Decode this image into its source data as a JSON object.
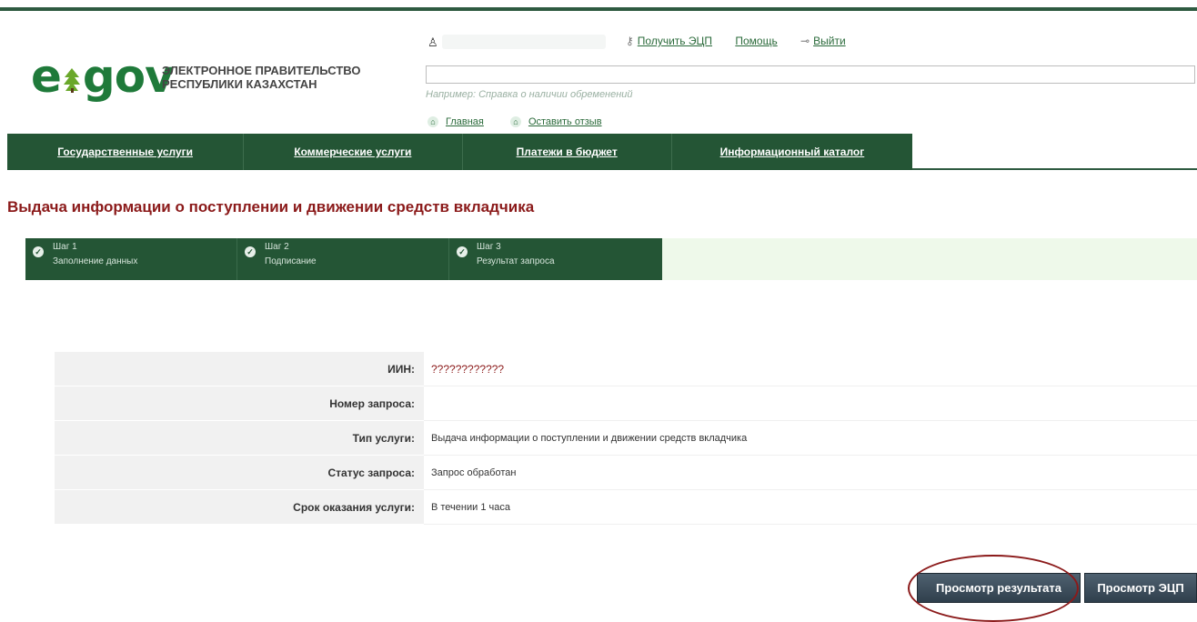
{
  "header": {
    "logo_text": "egov",
    "caption_line1": "ЭЛЕКТРОННОЕ ПРАВИТЕЛЬСТВО",
    "caption_line2": "РЕСПУБЛИКИ КАЗАХСТАН",
    "links": {
      "get_ecp": "Получить ЭЦП",
      "help": "Помощь",
      "logout": "Выйти"
    },
    "search": {
      "value": "",
      "hint": "Например: Справка о наличии обременений"
    },
    "sublinks": {
      "home": "Главная",
      "feedback": "Оставить отзыв"
    }
  },
  "nav": {
    "items": [
      "Государственные услуги",
      "Коммерческие услуги",
      "Платежи в бюджет",
      "Информационный каталог"
    ]
  },
  "page_title": "Выдача информации о поступлении и движении средств вкладчика",
  "steps": [
    {
      "num": "Шаг 1",
      "desc": "Заполнение данных"
    },
    {
      "num": "Шаг 2",
      "desc": "Подписание"
    },
    {
      "num": "Шаг 3",
      "desc": "Результат запроса"
    }
  ],
  "info": {
    "rows": [
      {
        "label": "ИИН:",
        "value": "????????????"
      },
      {
        "label": "Номер запроса:",
        "value": ""
      },
      {
        "label": "Тип услуги:",
        "value": "Выдача информации о поступлении и движении средств вкладчика"
      },
      {
        "label": "Статус запроса:",
        "value": "Запрос обработан"
      },
      {
        "label": "Срок оказания услуги:",
        "value": "В течении 1 часа"
      }
    ]
  },
  "buttons": {
    "view_result": "Просмотр результата",
    "view_ecp": "Просмотр ЭЦП"
  },
  "colors": {
    "brand_green": "#245535",
    "title_red": "#8b1a1a"
  }
}
